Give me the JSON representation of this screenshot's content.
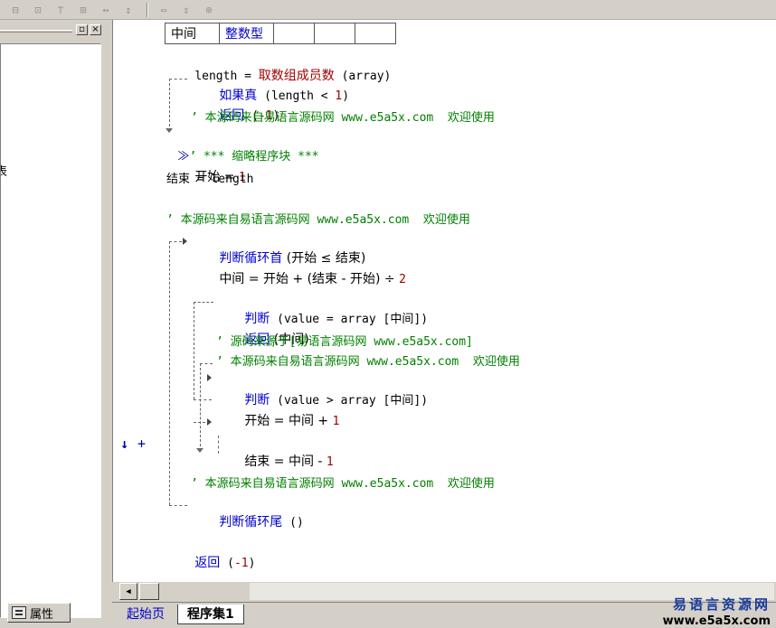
{
  "vartable": {
    "name": "中间",
    "type": "整数型"
  },
  "code": {
    "l1": {
      "a": "length = ",
      "b": "取数组成员数",
      "c": " (array)"
    },
    "l2": {
      "a": "如果真",
      "b": " (length < ",
      "c": "1",
      "d": ")"
    },
    "l3": {
      "a": "返回",
      "b": " (",
      "c": "-1",
      "d": ")"
    },
    "l4": "’ 本源码来自易语言源码网 www.e5a5x.com  欢迎使用",
    "l5": {
      "a": "≫",
      "b": "’ *** 缩略程序块 ***"
    },
    "l6": {
      "a": "开始 = ",
      "b": "1"
    },
    "l7": "结束 = length",
    "l8": "’ 本源码来自易语言源码网 www.e5a5x.com  欢迎使用",
    "l9": {
      "a": "判断循环首",
      "b": " (开始 ≤ 结束)"
    },
    "l10": {
      "a": "中间 = 开始 + (结束 - 开始) ÷ ",
      "b": "2"
    },
    "l11": {
      "a": "判断",
      "b": " (value = array [中间])"
    },
    "l12": {
      "a": "返回",
      "b": " (中间)"
    },
    "l13": "’ 源码来源于[易语言源码网 www.e5a5x.com]",
    "l14": "’ 本源码来自易语言源码网 www.e5a5x.com  欢迎使用",
    "l15": {
      "a": "判断",
      "b": " (value > array [中间])"
    },
    "l16": {
      "a": "开始 = 中间 + ",
      "b": "1"
    },
    "l17": {
      "a": "结束 = 中间 - ",
      "b": "1"
    },
    "l18": "’ 本源码来自易语言源码网 www.e5a5x.com  欢迎使用",
    "l19": {
      "a": "判断循环尾",
      "b": " ()"
    },
    "l20": {
      "a": "返回",
      "b": " (",
      "c": "-1",
      "d": ")"
    }
  },
  "gutter": {
    "down_arrow": "↓",
    "plus": "+"
  },
  "left_panel": {
    "cut_text": "表",
    "prop_tab": "属性"
  },
  "tabs": {
    "start_page": "起始页",
    "program_set": "程序集1"
  },
  "watermark": {
    "line1": "易语言资源网",
    "line2": "www.e5a5x.com"
  }
}
